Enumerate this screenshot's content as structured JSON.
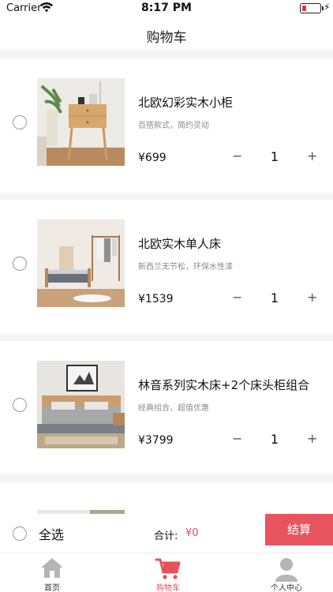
{
  "status_bar": {
    "carrier": "Carrier",
    "time": "8:17 PM"
  },
  "header": {
    "title": "购物车"
  },
  "cart": {
    "items": [
      {
        "title": "北欧幻彩实木小柜",
        "subtitle": "百搭款式，简约灵动",
        "price": "¥699",
        "quantity": "1",
        "minus": "−",
        "plus": "+"
      },
      {
        "title": "北欧实木单人床",
        "subtitle": "新西兰无节松，环保水性漆",
        "price": "¥1539",
        "quantity": "1",
        "minus": "−",
        "plus": "+"
      },
      {
        "title": "林音系列实木床+2个床头柜组合",
        "subtitle": "经典组合，超值优惠",
        "price": "¥3799",
        "quantity": "1",
        "minus": "−",
        "plus": "+"
      }
    ]
  },
  "checkout": {
    "select_all": "全选",
    "total_label": "合计:",
    "total_value": "¥0",
    "button": "结算"
  },
  "tabs": [
    {
      "label": "首页",
      "icon": "home-icon"
    },
    {
      "label": "购物车",
      "icon": "cart-icon"
    },
    {
      "label": "个人中心",
      "icon": "person-icon"
    }
  ],
  "colors": {
    "accent": "#e8545e",
    "price_red": "#e8505b",
    "divider": "#f4f4f4"
  }
}
